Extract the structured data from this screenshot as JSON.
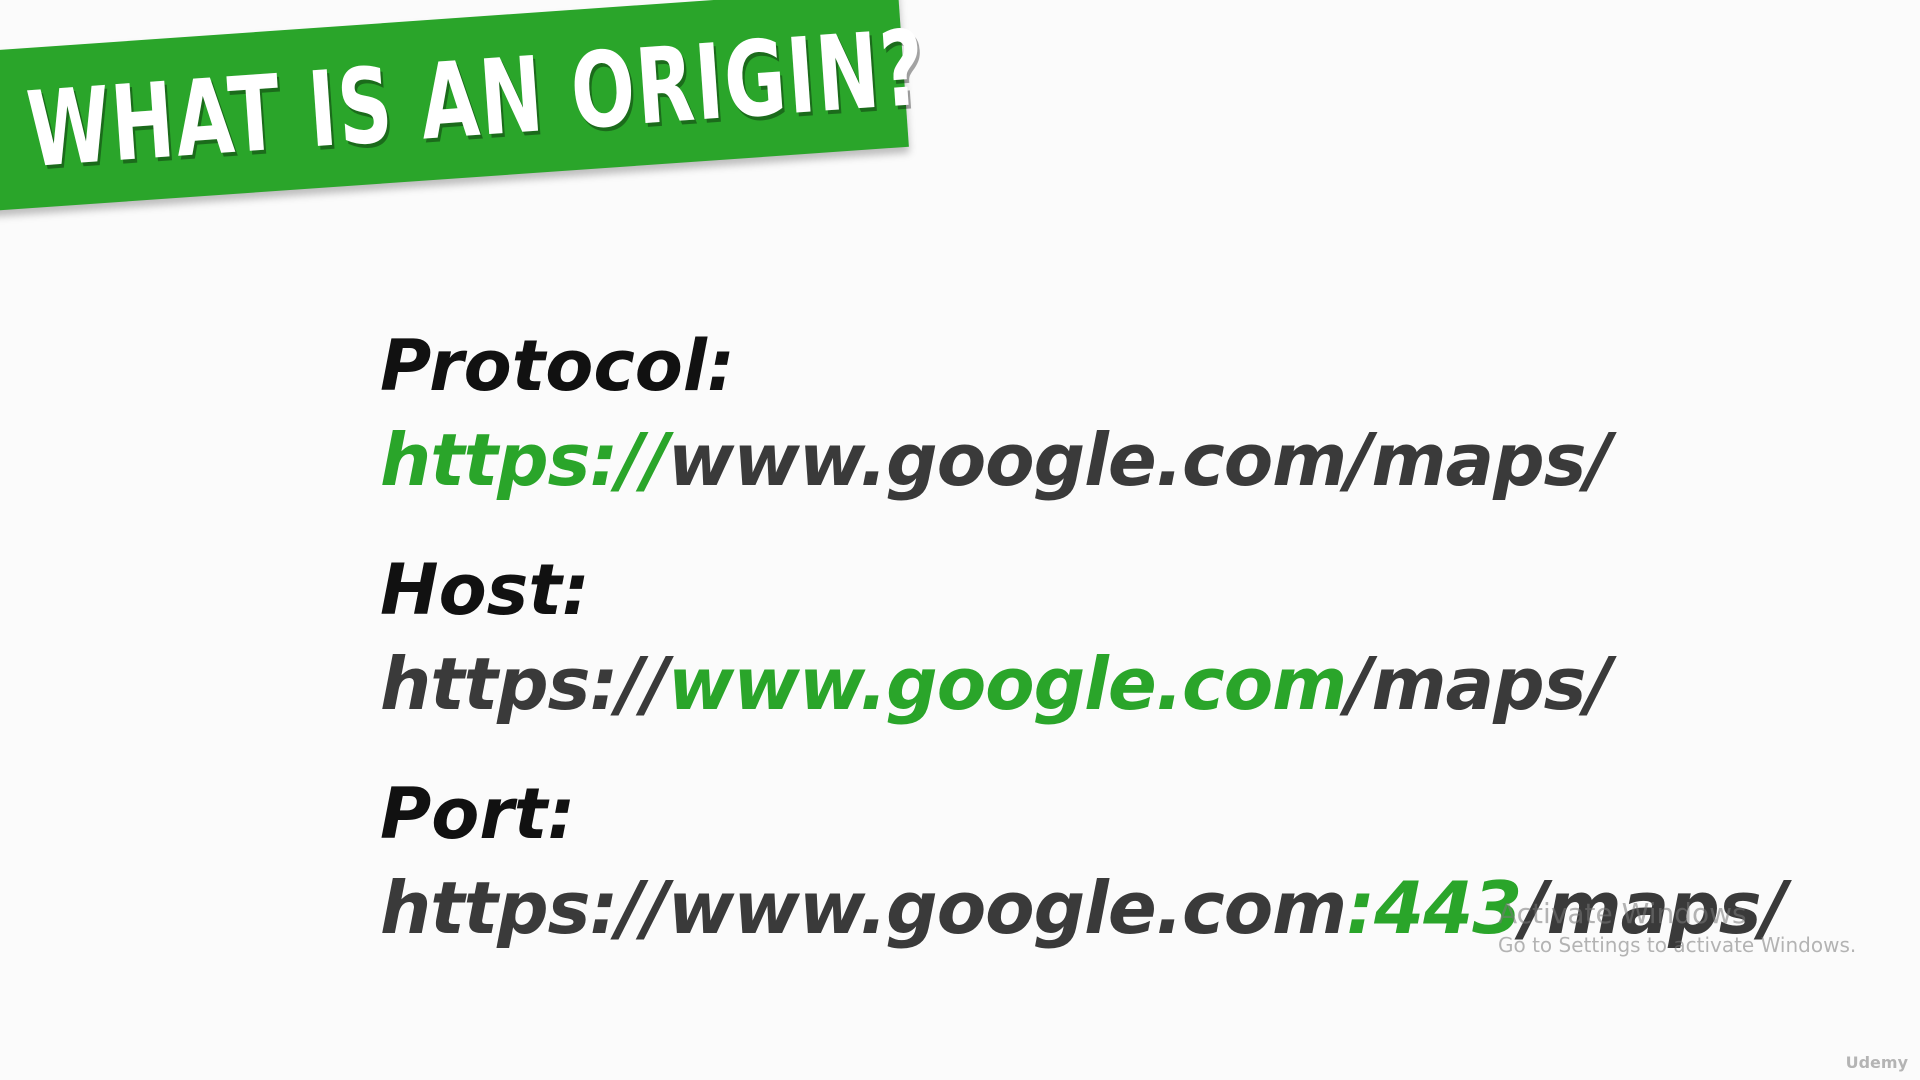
{
  "title": "WHAT IS AN ORIGIN?",
  "colors": {
    "accent": "#2aa52a",
    "text_dark": "#111111",
    "text_url": "#3a3a3a",
    "background": "#fbfbfb"
  },
  "sections": [
    {
      "label": "Protocol:",
      "url_parts": [
        {
          "text": "https://",
          "highlight": true
        },
        {
          "text": "www.google.com/maps/",
          "highlight": false
        }
      ]
    },
    {
      "label": "Host:",
      "url_parts": [
        {
          "text": "https://",
          "highlight": false
        },
        {
          "text": "www.google.com",
          "highlight": true
        },
        {
          "text": "/maps/",
          "highlight": false
        }
      ]
    },
    {
      "label": "Port:",
      "url_parts": [
        {
          "text": "https://www.google.com",
          "highlight": false
        },
        {
          "text": ":443",
          "highlight": true
        },
        {
          "text": "/maps/",
          "highlight": false
        }
      ]
    }
  ],
  "watermark": {
    "title": "Activate Windows",
    "subtitle": "Go to Settings to activate Windows."
  },
  "brand": "Udemy"
}
